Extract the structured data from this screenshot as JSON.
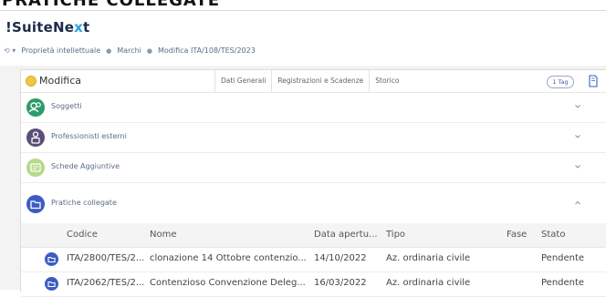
{
  "banner": {
    "text": "PRATICHE COLLEGATE"
  },
  "app": {
    "logo_prefix": "!Suite",
    "logo_mid": "Ne",
    "logo_x": "x",
    "logo_end": "t"
  },
  "breadcrumb": {
    "nav": "⟲ ▾",
    "items": [
      "Proprietà intellettuale",
      "Marchi",
      "Modifica ITA/108/TES/2023"
    ]
  },
  "card": {
    "title": "Modifica",
    "tabs": [
      "Dati Generali",
      "Registrazioni e Scadenze",
      "Storico"
    ],
    "tag_button": "1 Tag"
  },
  "sections": [
    {
      "label": "Soggetti",
      "icon": "people-icon",
      "color": "#2d9b6a",
      "expanded": false
    },
    {
      "label": "Professionisti esterni",
      "icon": "professional-icon",
      "color": "#5a4f7a",
      "expanded": false
    },
    {
      "label": "Schede Aggiuntive",
      "icon": "cards-icon",
      "color": "#b7d98a",
      "expanded": false
    },
    {
      "label": "Pratiche collegate",
      "icon": "folder-icon",
      "color": "#3d5cc2",
      "expanded": true
    }
  ],
  "table": {
    "headers": [
      "Codice",
      "Nome",
      "Data apertu...",
      "Tipo",
      "Fase",
      "Stato"
    ],
    "rows": [
      {
        "codice": "ITA/2800/TES/2...",
        "nome": "clonazione 14 Ottobre contenzio...",
        "data": "14/10/2022",
        "tipo": "Az. ordinaria civile",
        "fase": "",
        "stato": "Pendente"
      },
      {
        "codice": "ITA/2062/TES/2...",
        "nome": "Contenzioso Convenzione Deleg...",
        "data": "16/03/2022",
        "tipo": "Az. ordinaria civile",
        "fase": "",
        "stato": "Pendente"
      }
    ]
  }
}
